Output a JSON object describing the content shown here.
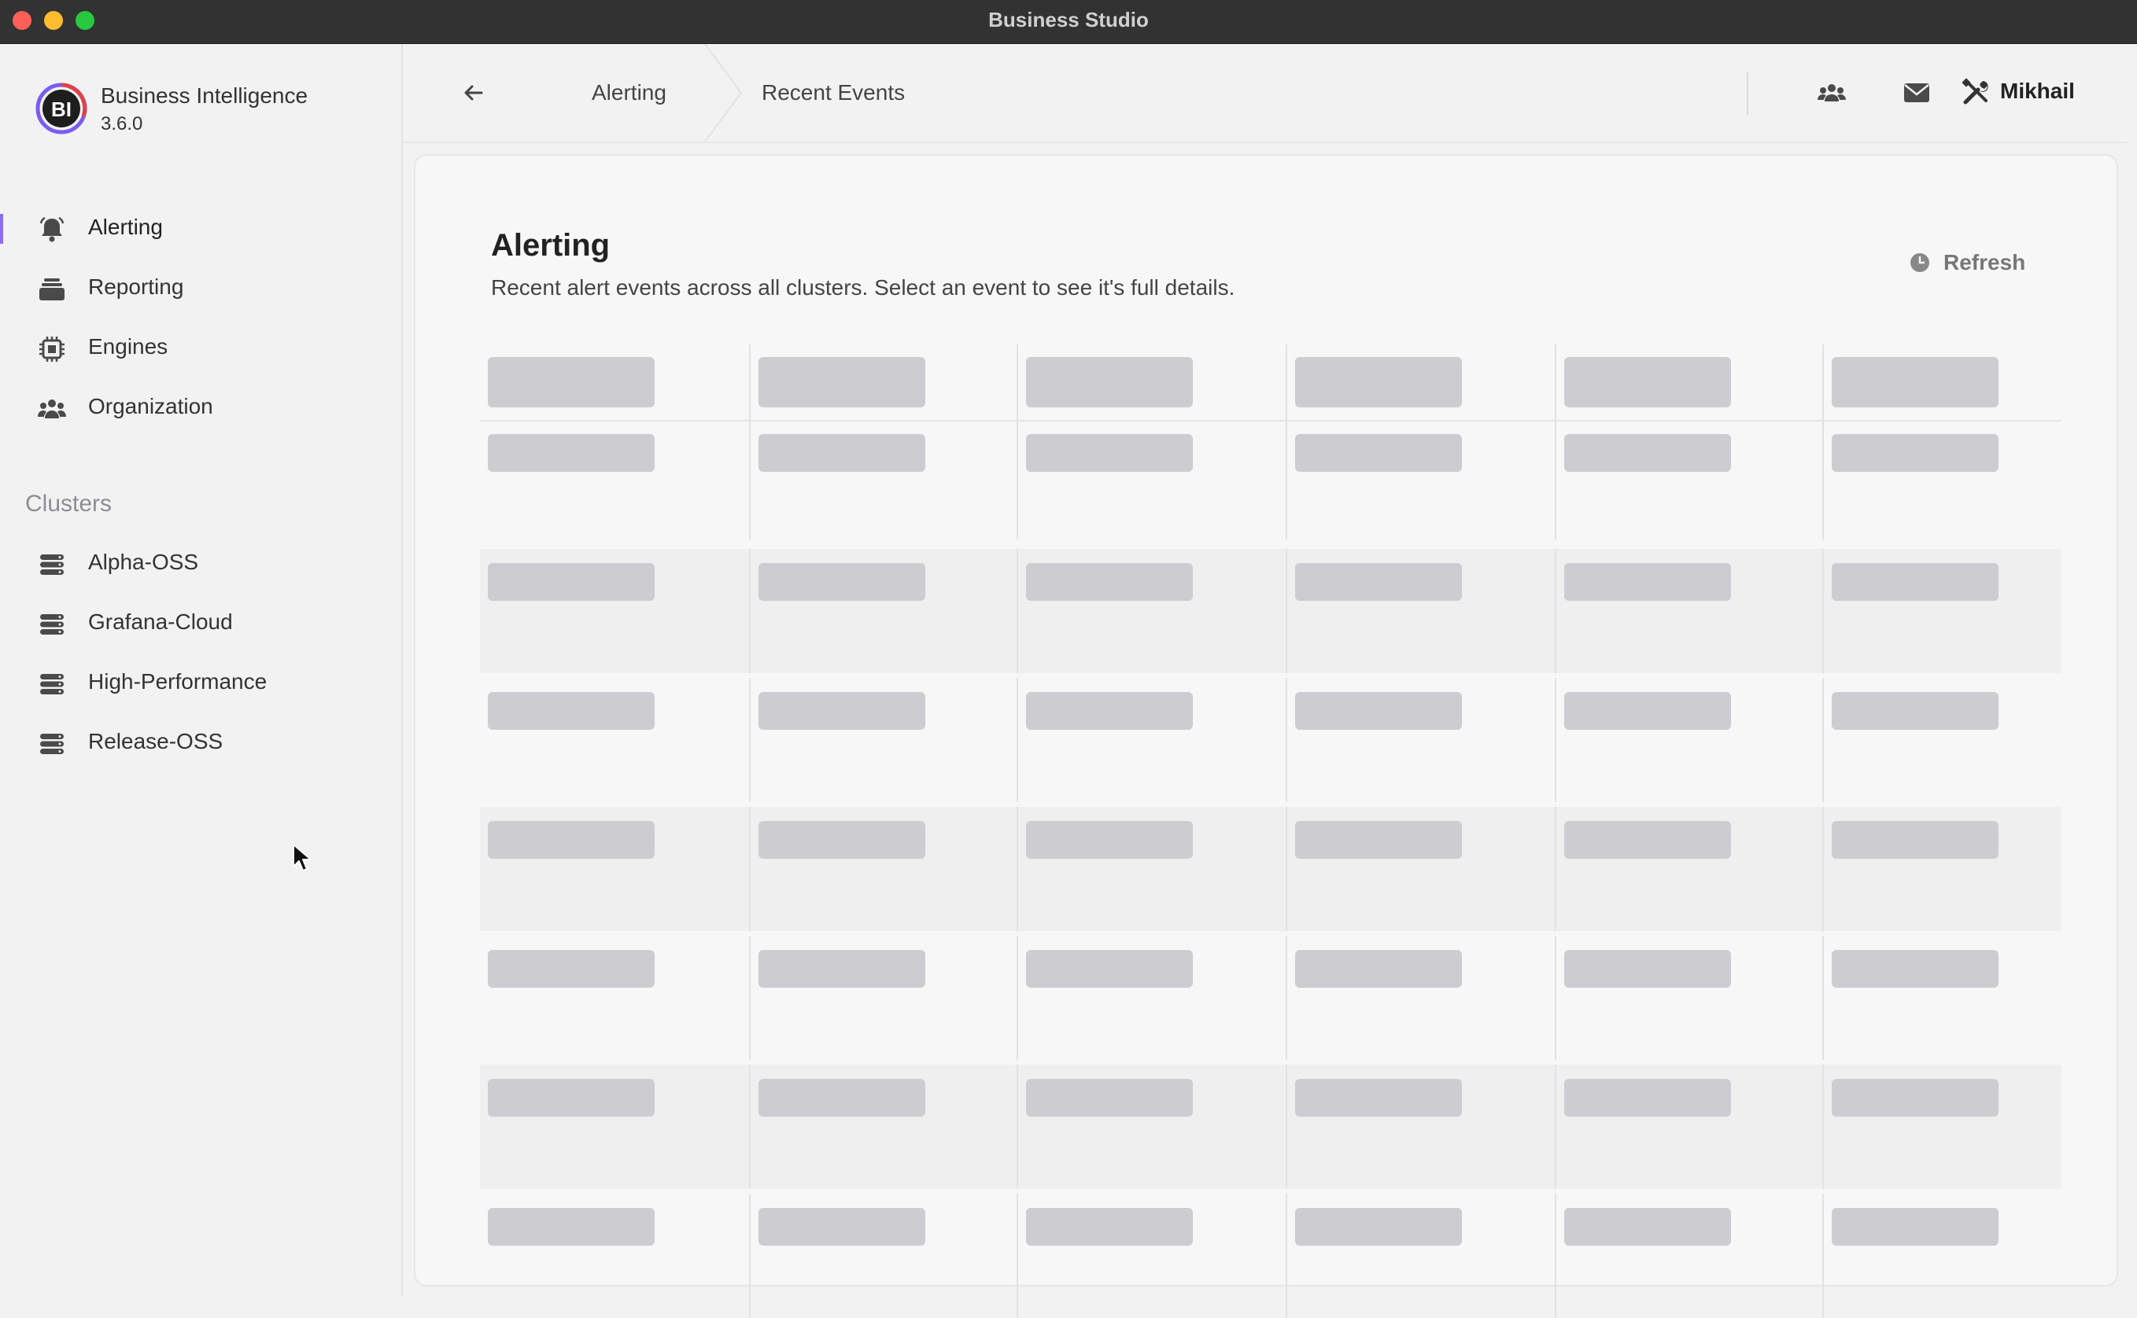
{
  "window": {
    "title": "Business Studio"
  },
  "app": {
    "name": "Business Intelligence",
    "version": "3.6.0",
    "logo_text": "BI"
  },
  "sidebar": {
    "nav": [
      {
        "label": "Alerting",
        "icon": "bell-icon",
        "active": true
      },
      {
        "label": "Reporting",
        "icon": "stack-icon",
        "active": false
      },
      {
        "label": "Engines",
        "icon": "chip-icon",
        "active": false
      },
      {
        "label": "Organization",
        "icon": "users-icon",
        "active": false
      }
    ],
    "clusters_label": "Clusters",
    "clusters": [
      {
        "label": "Alpha-OSS",
        "icon": "database-icon"
      },
      {
        "label": "Grafana-Cloud",
        "icon": "database-icon"
      },
      {
        "label": "High-Performance",
        "icon": "database-icon"
      },
      {
        "label": "Release-OSS",
        "icon": "database-icon"
      }
    ]
  },
  "topbar": {
    "breadcrumb": [
      "Alerting",
      "Recent Events"
    ],
    "icons": [
      "users-icon",
      "mail-icon"
    ],
    "user": {
      "name": "Mikhail",
      "icon": "tools-icon"
    }
  },
  "main": {
    "title": "Alerting",
    "subtitle": "Recent alert events across all clusters. Select an event to see it's full details.",
    "refresh_label": "Refresh",
    "table": {
      "state": "loading",
      "columns": 6,
      "rows": 7
    }
  },
  "colors": {
    "accent": "#8b6cf0",
    "skeleton": "#ccccd1"
  }
}
